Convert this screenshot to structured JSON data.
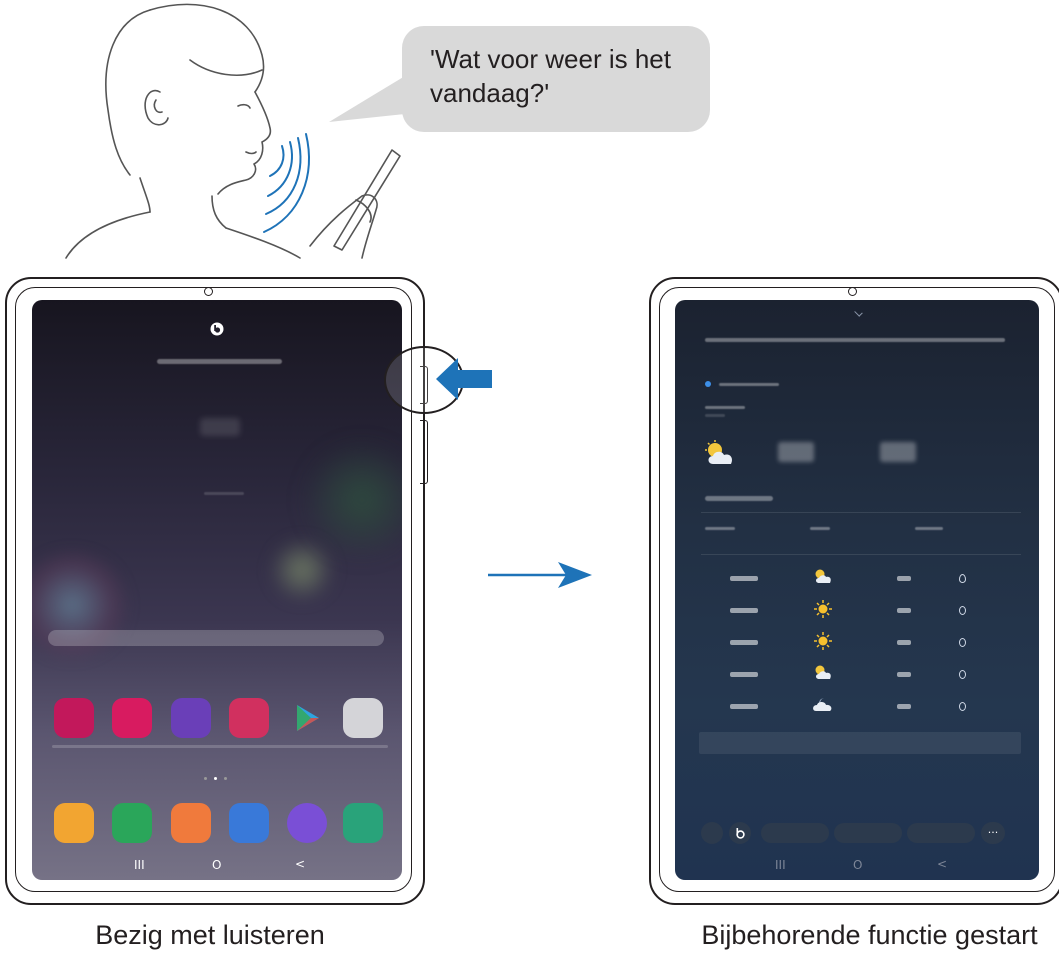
{
  "speech_bubble": {
    "text": "'Wat voor weer is het vandaag?'"
  },
  "captions": {
    "left": "Bezig met luisteren",
    "right": "Bijbehorende functie gestart"
  },
  "left_screen": {
    "assistant_icon": "bixby-icon",
    "nav": {
      "recents": "III",
      "home": "O",
      "back": "<"
    }
  },
  "right_screen": {
    "nav": {
      "recents": "III",
      "home": "O",
      "back": "<"
    },
    "more_label": "..."
  },
  "colors": {
    "arrow_blue": "#1e73b8",
    "bubble_gray": "#d9d9d9"
  }
}
